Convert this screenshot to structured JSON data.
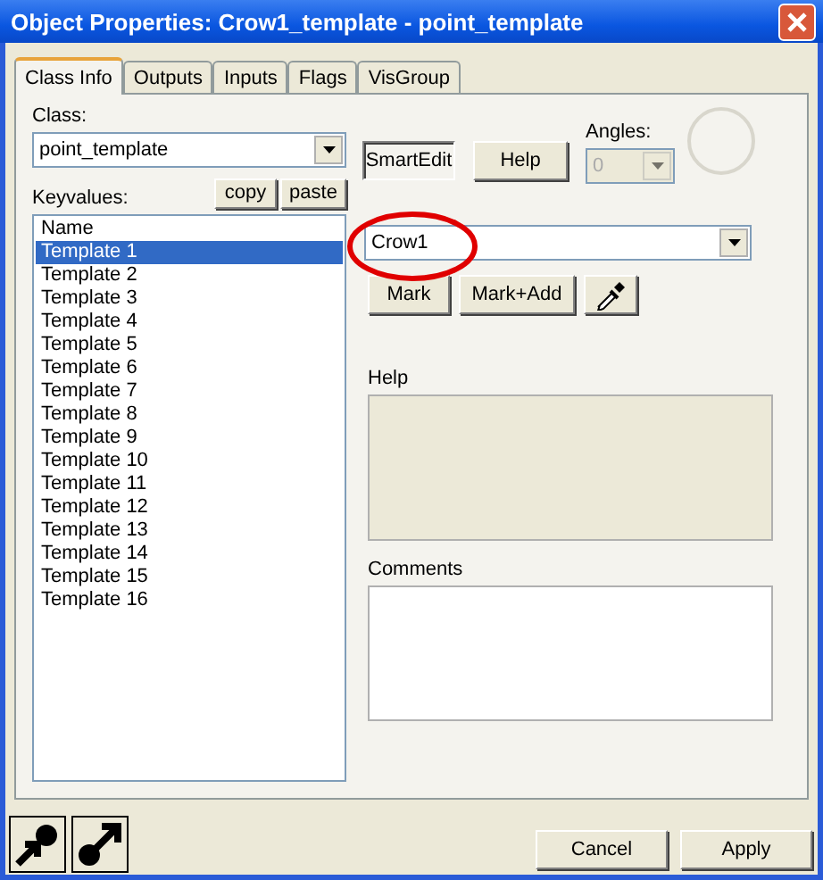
{
  "window": {
    "title": "Object Properties: Crow1_template - point_template"
  },
  "tabs": [
    {
      "label": "Class Info",
      "selected": true
    },
    {
      "label": "Outputs",
      "selected": false
    },
    {
      "label": "Inputs",
      "selected": false
    },
    {
      "label": "Flags",
      "selected": false
    },
    {
      "label": "VisGroup",
      "selected": false
    }
  ],
  "class": {
    "label": "Class:",
    "value": "point_template"
  },
  "smartedit": {
    "label": "SmartEdit",
    "pressed": true
  },
  "help_button": "Help",
  "angles": {
    "label": "Angles:",
    "value": "0",
    "disabled": true
  },
  "keyvalues": {
    "label": "Keyvalues:",
    "copy": "copy",
    "paste": "paste",
    "rows": [
      {
        "text": "Name",
        "selected": false
      },
      {
        "text": "Template 1",
        "selected": true
      },
      {
        "text": "Template 2",
        "selected": false
      },
      {
        "text": "Template 3",
        "selected": false
      },
      {
        "text": "Template 4",
        "selected": false
      },
      {
        "text": "Template 5",
        "selected": false
      },
      {
        "text": "Template 6",
        "selected": false
      },
      {
        "text": "Template 7",
        "selected": false
      },
      {
        "text": "Template 8",
        "selected": false
      },
      {
        "text": "Template 9",
        "selected": false
      },
      {
        "text": "Template 10",
        "selected": false
      },
      {
        "text": "Template 11",
        "selected": false
      },
      {
        "text": "Template 12",
        "selected": false
      },
      {
        "text": "Template 13",
        "selected": false
      },
      {
        "text": "Template 14",
        "selected": false
      },
      {
        "text": "Template 15",
        "selected": false
      },
      {
        "text": "Template 16",
        "selected": false
      }
    ]
  },
  "value": {
    "value": "Crow1"
  },
  "mark": "Mark",
  "mark_add": "Mark+Add",
  "help": {
    "label": "Help"
  },
  "comments": {
    "label": "Comments"
  },
  "footer": {
    "cancel": "Cancel",
    "apply": "Apply"
  }
}
